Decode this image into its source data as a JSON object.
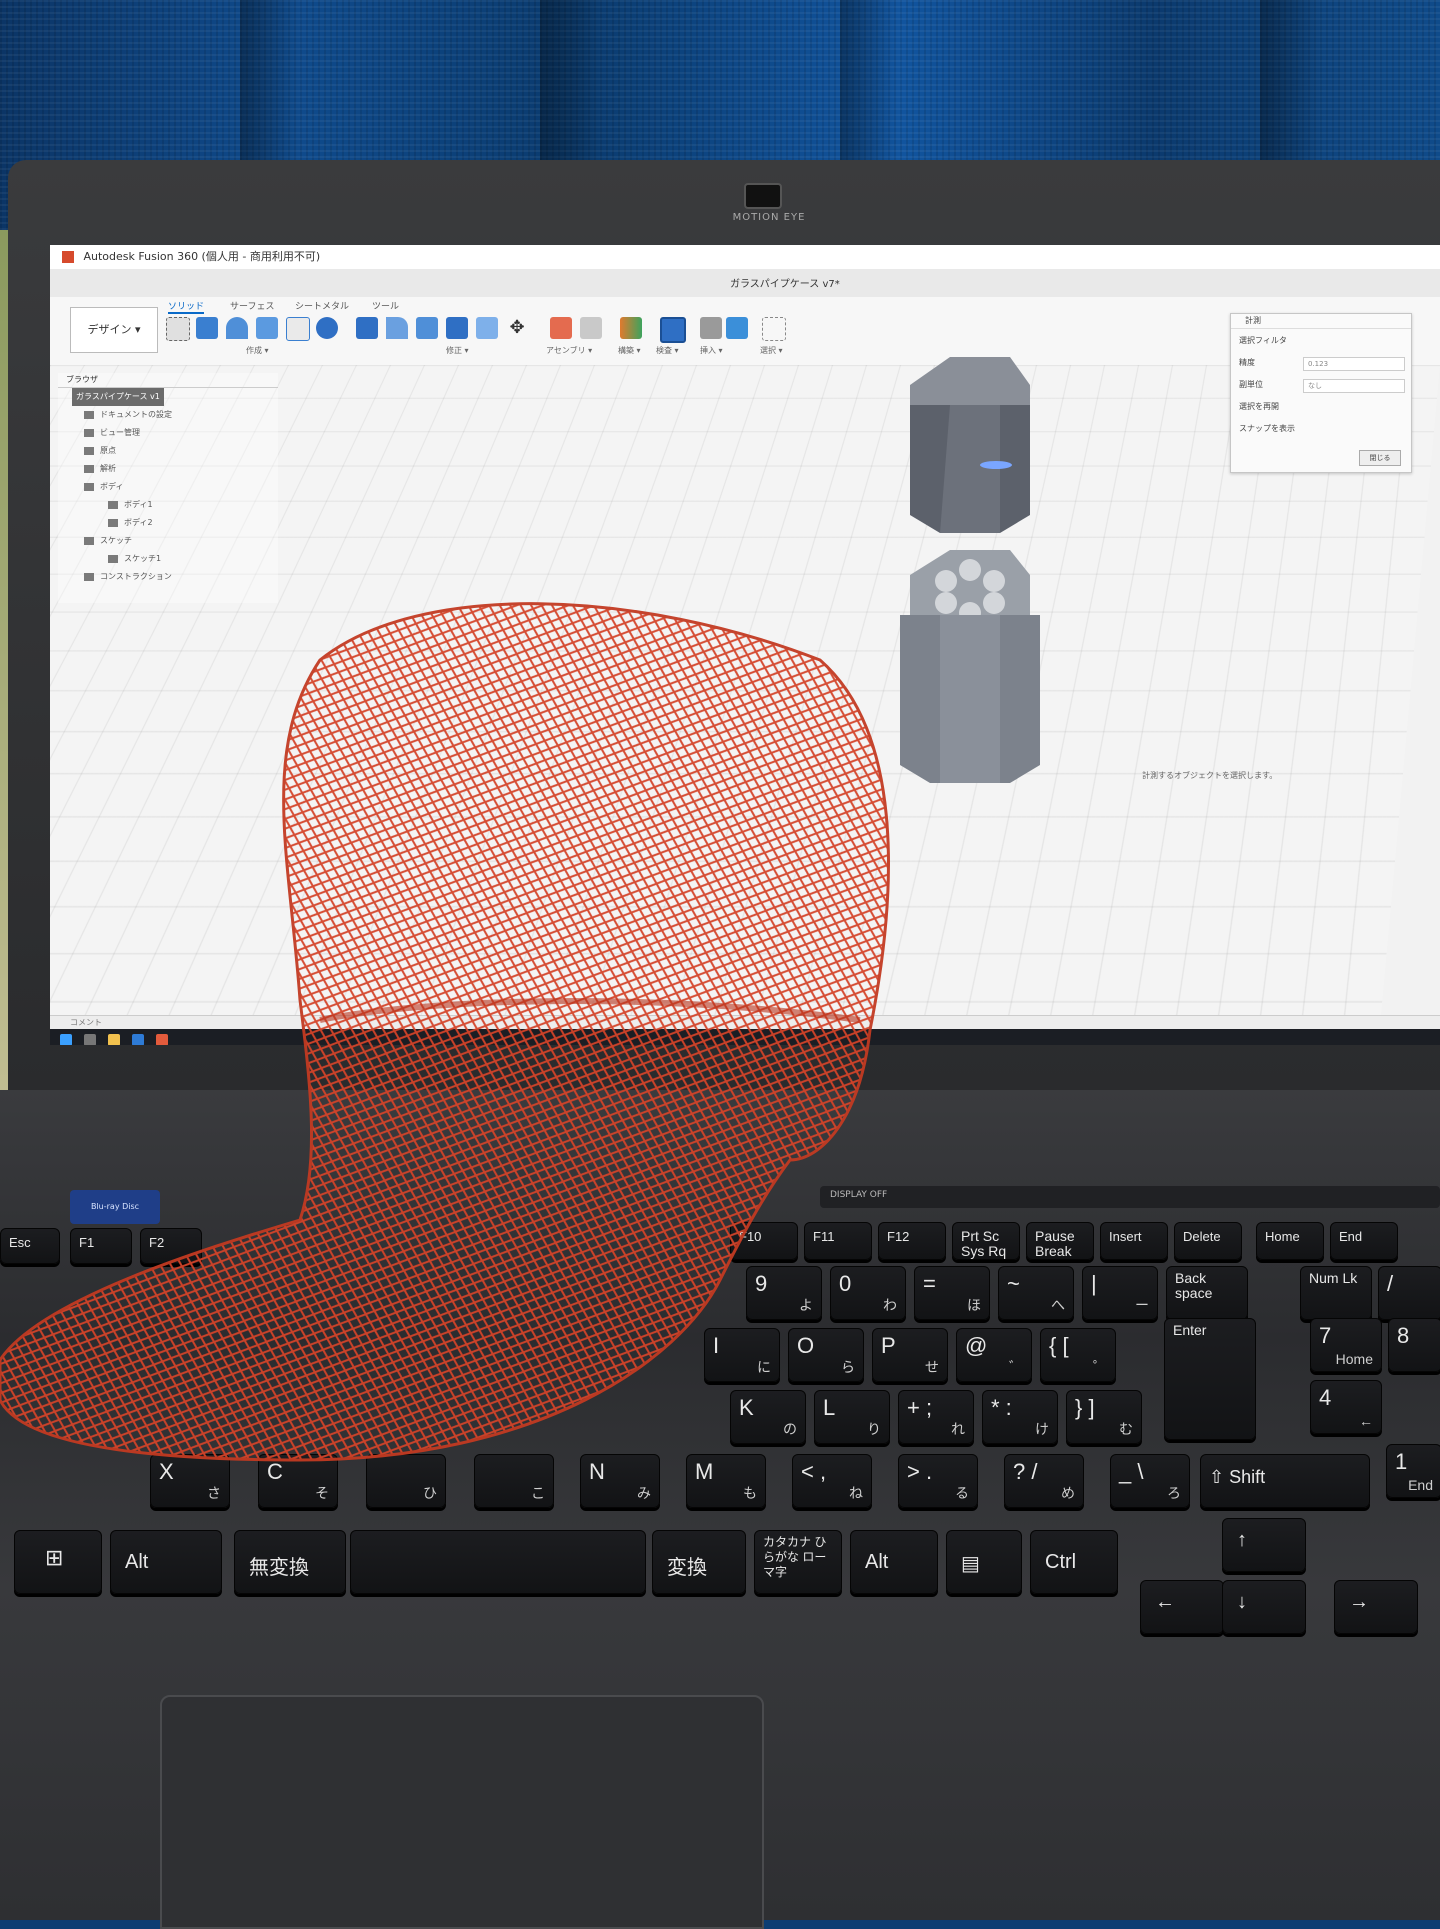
{
  "scene": "photo",
  "fusion": {
    "window_title": "Autodesk Fusion 360 (個人用 - 商用利用不可)",
    "doc_tab": "ガラスパイプケース v7*",
    "design_button": "デザイン ▾",
    "ribbon_tabs": [
      "ソリッド",
      "サーフェス",
      "シートメタル",
      "ツール"
    ],
    "groups": [
      "作成 ▾",
      "修正 ▾",
      "アセンブリ ▾",
      "構築 ▾",
      "検査 ▾",
      "挿入 ▾",
      "選択 ▾"
    ],
    "browser": {
      "title": "ブラウザ",
      "root": "ガラスパイプケース v1",
      "items": [
        "ドキュメントの設定",
        "ビュー管理",
        "原点",
        "解析",
        "ボディ",
        "ボディ1",
        "ボディ2",
        "スケッチ",
        "スケッチ1",
        "コンストラクション"
      ]
    },
    "select_panel": {
      "title": "計測",
      "rows": [
        "選択フィルタ",
        "精度",
        "副単位",
        "選択を再開",
        "スナップを表示"
      ],
      "precision_value": "0.123",
      "unit_value": "なし",
      "close": "閉じる"
    },
    "status_hint": "計測するオブジェクトを選択します。",
    "timeline_label": "コメント"
  },
  "laptop": {
    "webcam_label": "MOTION EYE",
    "bluray_label": "Blu-ray Disc",
    "media_label": "DISPLAY OFF"
  },
  "keys": [
    {
      "id": "esc",
      "main": "Esc",
      "sub": ""
    },
    {
      "id": "f1",
      "main": "F1",
      "sub": ""
    },
    {
      "id": "f2",
      "main": "F2",
      "sub": ""
    },
    {
      "id": "f10",
      "main": "F10",
      "sub": ""
    },
    {
      "id": "f11",
      "main": "F11",
      "sub": ""
    },
    {
      "id": "f12",
      "main": "F12",
      "sub": ""
    },
    {
      "id": "prtsc",
      "main": "Prt Sc Sys Rq",
      "sub": ""
    },
    {
      "id": "pause",
      "main": "Pause Break",
      "sub": ""
    },
    {
      "id": "insert",
      "main": "Insert",
      "sub": ""
    },
    {
      "id": "delete",
      "main": "Delete",
      "sub": ""
    },
    {
      "id": "home",
      "main": "Home",
      "sub": ""
    },
    {
      "id": "end",
      "main": "End",
      "sub": ""
    },
    {
      "id": "k9",
      "main": "9",
      "sub": "よ"
    },
    {
      "id": "k0",
      "main": "0",
      "sub": "わ"
    },
    {
      "id": "minus",
      "main": "=",
      "sub": "ほ"
    },
    {
      "id": "caret",
      "main": "~",
      "sub": "へ"
    },
    {
      "id": "yen",
      "main": "|",
      "sub": "ー"
    },
    {
      "id": "backspace",
      "main": "Back space",
      "sub": ""
    },
    {
      "id": "numlk",
      "main": "Num Lk",
      "sub": ""
    },
    {
      "id": "slash",
      "main": "/",
      "sub": ""
    },
    {
      "id": "ki",
      "main": "I",
      "sub": "に"
    },
    {
      "id": "ko",
      "main": "O",
      "sub": "ら"
    },
    {
      "id": "kp",
      "main": "P",
      "sub": "せ"
    },
    {
      "id": "at",
      "main": "@",
      "sub": "゛"
    },
    {
      "id": "bracket",
      "main": "{ [",
      "sub": "゜"
    },
    {
      "id": "enter",
      "main": "Enter",
      "sub": ""
    },
    {
      "id": "n7",
      "main": "7",
      "sub": "Home"
    },
    {
      "id": "n8",
      "main": "8",
      "sub": ""
    },
    {
      "id": "kk",
      "main": "K",
      "sub": "の"
    },
    {
      "id": "kl",
      "main": "L",
      "sub": "り"
    },
    {
      "id": "semi",
      "main": "+ ;",
      "sub": "れ"
    },
    {
      "id": "colon",
      "main": "* :",
      "sub": "け"
    },
    {
      "id": "rbracket",
      "main": "} ]",
      "sub": "む"
    },
    {
      "id": "n4",
      "main": "4",
      "sub": "←"
    },
    {
      "id": "kx",
      "main": "X",
      "sub": "さ"
    },
    {
      "id": "kc",
      "main": "C",
      "sub": "そ"
    },
    {
      "id": "kv",
      "main": "",
      "sub": "ひ"
    },
    {
      "id": "kb",
      "main": "",
      "sub": "こ"
    },
    {
      "id": "kn",
      "main": "N",
      "sub": "み"
    },
    {
      "id": "km",
      "main": "M",
      "sub": "も"
    },
    {
      "id": "comma",
      "main": "< ,",
      "sub": "ね"
    },
    {
      "id": "period",
      "main": "> .",
      "sub": "る"
    },
    {
      "id": "question",
      "main": "? /",
      "sub": "め"
    },
    {
      "id": "backslash",
      "main": "_ \\",
      "sub": "ろ"
    },
    {
      "id": "shift",
      "main": "⇧ Shift",
      "sub": ""
    },
    {
      "id": "n1",
      "main": "1",
      "sub": "End"
    },
    {
      "id": "win",
      "main": "⊞",
      "sub": ""
    },
    {
      "id": "alt",
      "main": "Alt",
      "sub": ""
    },
    {
      "id": "muhenkan",
      "main": "無変換",
      "sub": ""
    },
    {
      "id": "space",
      "main": "",
      "sub": ""
    },
    {
      "id": "henkan",
      "main": "変換",
      "sub": ""
    },
    {
      "id": "kana",
      "main": "カタカナ ひらがな ローマ字",
      "sub": ""
    },
    {
      "id": "alt2",
      "main": "Alt",
      "sub": ""
    },
    {
      "id": "menu",
      "main": "▤",
      "sub": ""
    },
    {
      "id": "ctrl",
      "main": "Ctrl",
      "sub": ""
    },
    {
      "id": "up",
      "main": "↑",
      "sub": ""
    },
    {
      "id": "left",
      "main": "←",
      "sub": ""
    },
    {
      "id": "down",
      "main": "↓",
      "sub": ""
    },
    {
      "id": "right",
      "main": "→",
      "sub": ""
    }
  ],
  "colors": {
    "curtain": "#0f4b8d",
    "net": "#d4442a",
    "case_body": "#7c828c",
    "laptop": "#2d2e31"
  }
}
